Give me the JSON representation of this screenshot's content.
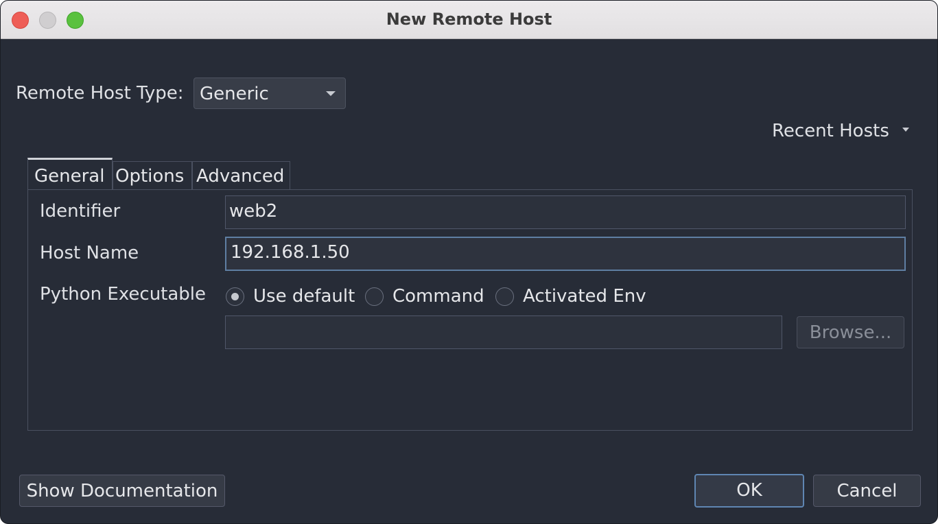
{
  "window": {
    "title": "New Remote Host"
  },
  "host_type": {
    "label": "Remote Host Type:",
    "selected": "Generic"
  },
  "recent_hosts": {
    "label": "Recent Hosts"
  },
  "tabs": [
    {
      "label": "General",
      "active": true
    },
    {
      "label": "Options",
      "active": false
    },
    {
      "label": "Advanced",
      "active": false
    }
  ],
  "general": {
    "identifier_label": "Identifier",
    "identifier_value": "web2",
    "host_name_label": "Host Name",
    "host_name_value": "192.168.1.50",
    "python_label": "Python Executable",
    "python_options": [
      {
        "label": "Use default",
        "checked": true
      },
      {
        "label": "Command",
        "checked": false
      },
      {
        "label": "Activated Env",
        "checked": false
      }
    ],
    "python_path_value": "",
    "browse_label": "Browse..."
  },
  "footer": {
    "show_docs_label": "Show Documentation",
    "ok_label": "OK",
    "cancel_label": "Cancel"
  },
  "colors": {
    "background": "#272c37",
    "accent_focus": "#5f7fa3"
  }
}
